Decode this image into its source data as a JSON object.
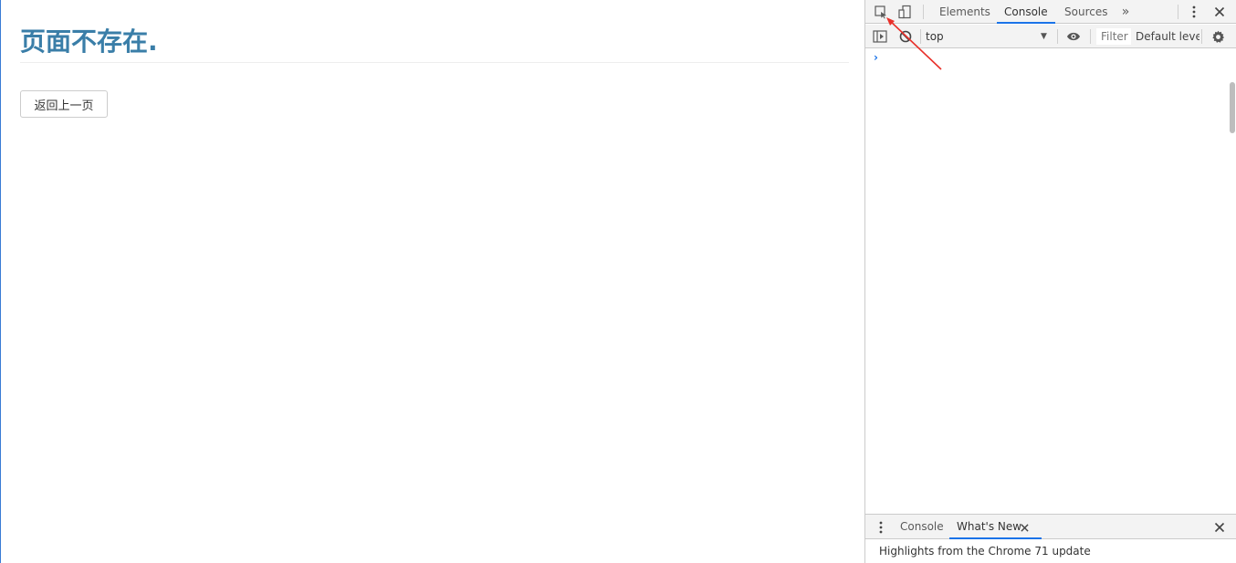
{
  "page": {
    "title": "页面不存在.",
    "back_button": "返回上一页"
  },
  "devtools": {
    "tabs": [
      "Elements",
      "Console",
      "Sources"
    ],
    "active_tab": "Console",
    "more_tabs_glyph": "»",
    "context": "top",
    "filter_placeholder": "Filter",
    "levels": "Default leve",
    "prompt_glyph": "›",
    "drawer_tabs": [
      "Console",
      "What's New"
    ],
    "drawer_active": "What's New",
    "drawer_text": "Highlights from the Chrome 71 update",
    "accent_color": "#1a73e8",
    "annotation_color": "#e8302a",
    "icons": [
      "inspect-element-icon",
      "device-toolbar-icon",
      "more-tabs-icon",
      "kebab-menu-icon",
      "close-icon",
      "sidebar-toggle-icon",
      "clear-console-icon",
      "eye-icon",
      "gear-icon"
    ]
  }
}
